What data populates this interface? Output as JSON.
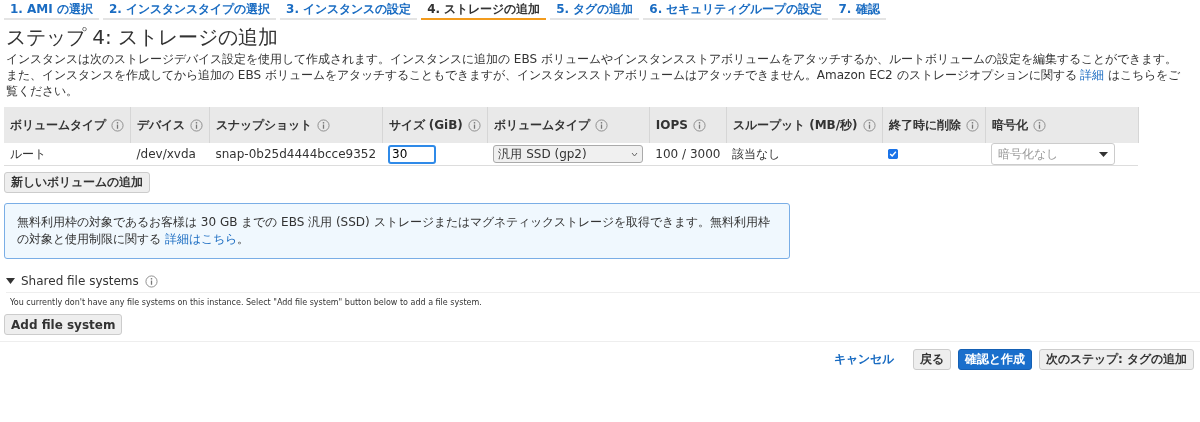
{
  "steps": [
    {
      "label": "1. AMI の選択",
      "selected": false
    },
    {
      "label": "2. インスタンスタイプの選択",
      "selected": false
    },
    {
      "label": "3. インスタンスの設定",
      "selected": false
    },
    {
      "label": "4. ストレージの追加",
      "selected": true
    },
    {
      "label": "5. タグの追加",
      "selected": false
    },
    {
      "label": "6. セキュリティグループの設定",
      "selected": false
    },
    {
      "label": "7. 確認",
      "selected": false
    }
  ],
  "title": "ステップ 4: ストレージの追加",
  "description": {
    "before": "インスタンスは次のストレージデバイス設定を使用して作成されます。インスタンスに追加の EBS ボリュームやインスタンスストアボリュームをアタッチするか、ルートボリュームの設定を編集することができます。また、インスタンスを作成してから追加の EBS ボリュームをアタッチすることもできますが、インスタンスストアボリュームはアタッチできません。Amazon EC2 のストレージオプションに関する ",
    "link": "詳細",
    "after": " はこちらをご覧ください。"
  },
  "table": {
    "columns": [
      "ボリュームタイプ",
      "デバイス",
      "スナップショット",
      "サイズ (GiB)",
      "ボリュームタイプ",
      "IOPS",
      "スループット (MB/秒)",
      "終了時に削除",
      "暗号化"
    ],
    "rows": [
      {
        "volume_type": "ルート",
        "device": "/dev/xvda",
        "snapshot": "snap-0b25d4444bcce9352",
        "size": "30",
        "type_select": "汎用 SSD (gp2)",
        "iops": "100 / 3000",
        "throughput": "該当なし",
        "delete_on_termination": true,
        "encryption_placeholder": "暗号化なし"
      }
    ]
  },
  "add_volume_button": "新しいボリュームの追加",
  "info": {
    "before": "無料利用枠の対象であるお客様は 30 GB までの EBS 汎用 (SSD) ストレージまたはマグネティックストレージを取得できます。無料利用枠の対象と使用制限に関する ",
    "link": "詳細はこちら",
    "after": "。"
  },
  "shared": {
    "title": "Shared file systems",
    "expanded": true,
    "message": "You currently don't have any file systems on this instance. Select \"Add file system\" button below to add a file system.",
    "button": "Add file system"
  },
  "footer": {
    "cancel": "キャンセル",
    "back": "戻る",
    "review": "確認と作成",
    "next": "次のステップ: タグの追加"
  }
}
